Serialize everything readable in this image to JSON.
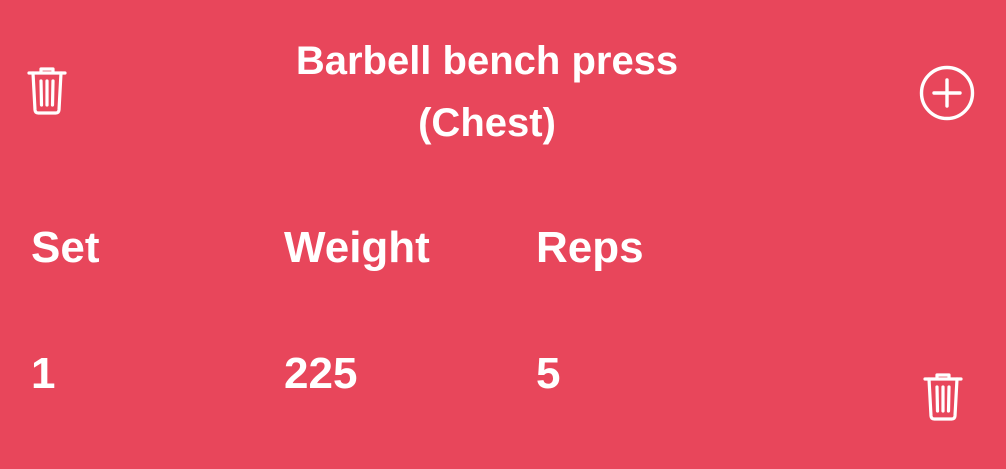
{
  "exercise": {
    "name": "Barbell bench press",
    "muscle_group": "(Chest)"
  },
  "table": {
    "headers": {
      "set": "Set",
      "weight": "Weight",
      "reps": "Reps"
    },
    "rows": [
      {
        "set": "1",
        "weight": "225",
        "reps": "5"
      }
    ]
  },
  "icons": {
    "delete_exercise": "trash-icon",
    "add_set": "plus-circle-icon",
    "delete_set": "trash-icon"
  },
  "colors": {
    "background": "#E8465B",
    "foreground": "#FFFFFF"
  }
}
